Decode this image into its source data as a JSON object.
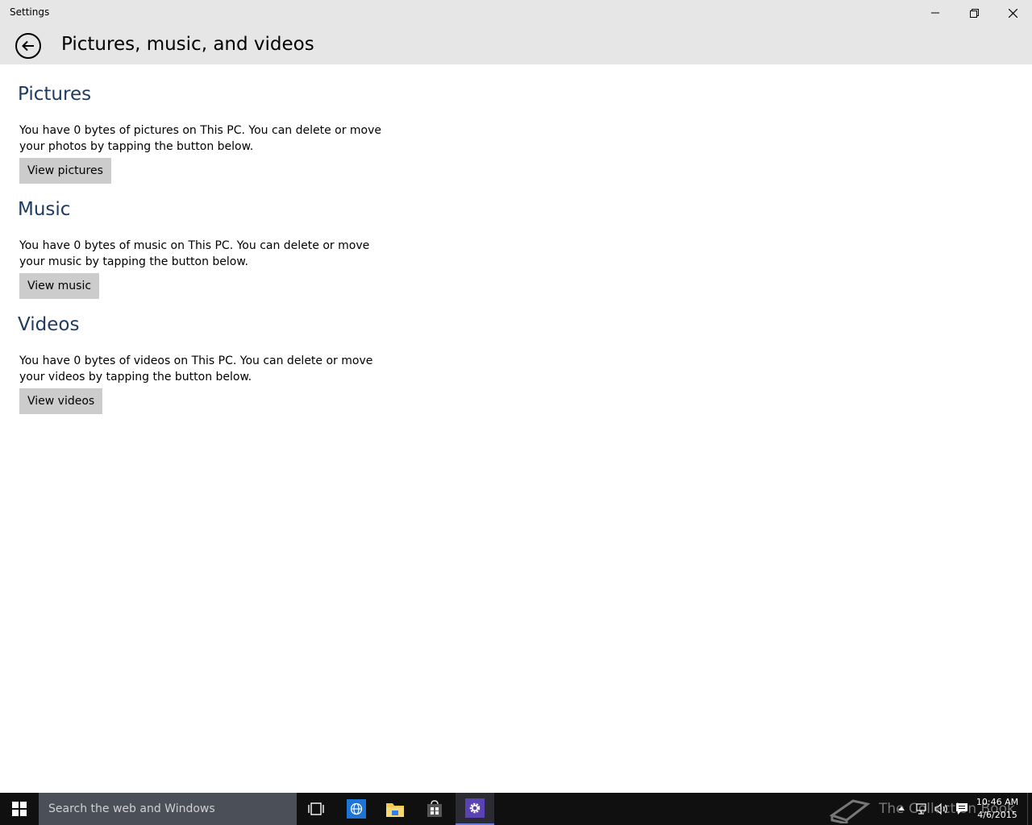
{
  "window": {
    "title": "Settings"
  },
  "header": {
    "title": "Pictures, music, and videos"
  },
  "sections": [
    {
      "title": "Pictures",
      "description": "You have 0 bytes of pictures on This PC. You can delete or move your photos by tapping the button below.",
      "button_label": "View pictures"
    },
    {
      "title": "Music",
      "description": "You have 0 bytes of music on This PC. You can delete or move your music by tapping the button below.",
      "button_label": "View music"
    },
    {
      "title": "Videos",
      "description": "You have 0 bytes of videos on This PC. You can delete or move your videos by tapping the button below.",
      "button_label": "View videos"
    }
  ],
  "taskbar": {
    "search_placeholder": "Search the web and Windows",
    "watermark": "The Collection Book",
    "clock_time": "10:46 AM",
    "clock_date": "4/6/2015",
    "icons": [
      "windows-logo-icon",
      "task-view-icon",
      "browser-icon",
      "file-explorer-icon",
      "store-icon",
      "settings-gear-icon"
    ],
    "tray_icons": [
      "chevron-up-icon",
      "network-icon",
      "volume-icon",
      "action-center-icon"
    ]
  },
  "colors": {
    "titlebar_bg": "#e6e6e6",
    "section_title": "#1e3a5f",
    "button_bg": "#cccccc",
    "taskbar_bg": "#101010",
    "search_bg": "#4b4f58",
    "active_indicator": "#6c7cd6"
  }
}
